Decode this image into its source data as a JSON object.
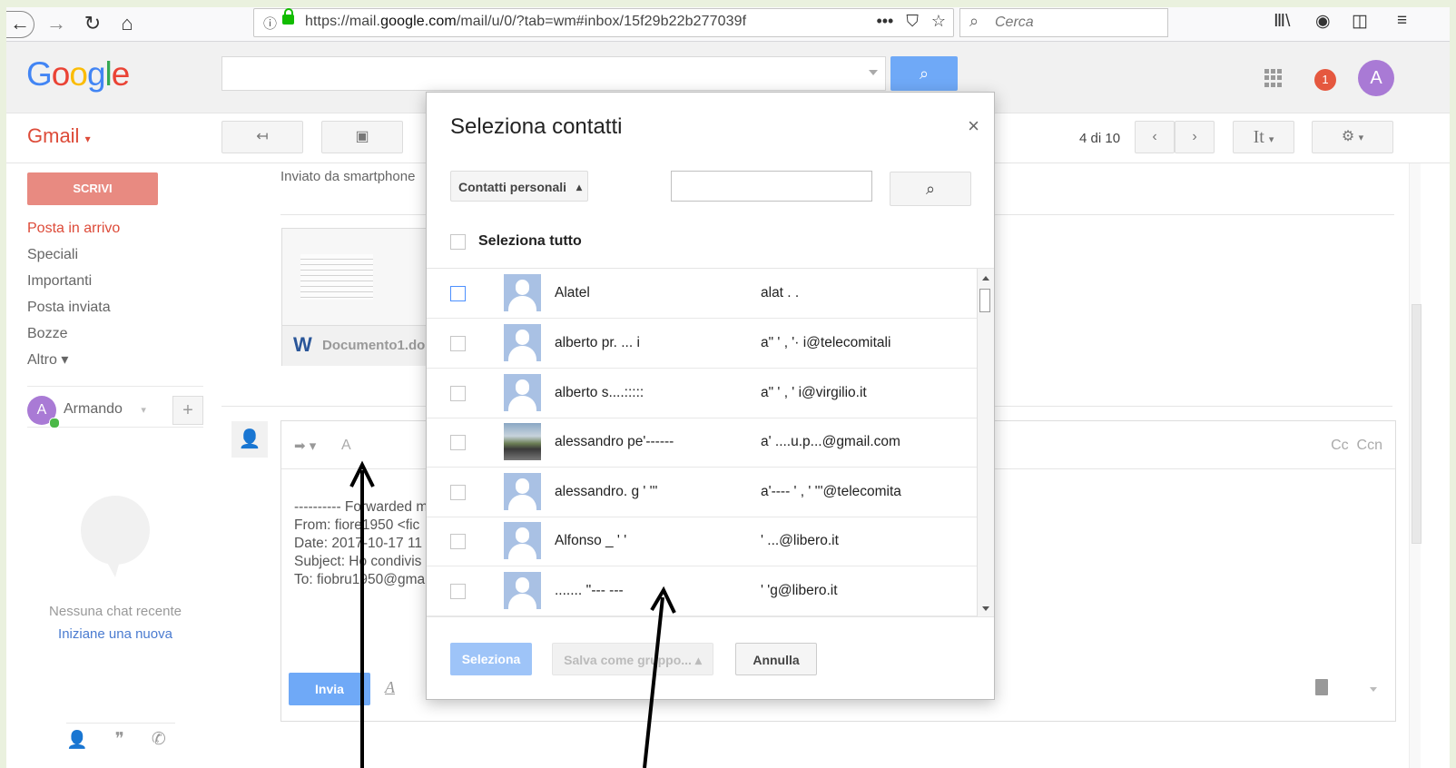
{
  "browser": {
    "url_prefix": "https://mail.",
    "url_domain": "google.com",
    "url_suffix": "/mail/u/0/?tab=wm#inbox/15f29b22b277039f",
    "search_placeholder": "Cerca",
    "icons": [
      "back-icon",
      "forward-icon",
      "reload-icon",
      "home-icon",
      "info-icon",
      "lock-icon",
      "menu-dots-icon",
      "pocket-icon",
      "star-icon",
      "search-icon",
      "library-icon",
      "extension-icon",
      "sidebar-icon",
      "hamburger-icon"
    ]
  },
  "header": {
    "logo": "Google",
    "notifications": "1",
    "avatar_letter": "A"
  },
  "toolbar": {
    "gmail_label": "Gmail",
    "pager": "4 di 10",
    "lang": "It"
  },
  "sidebar": {
    "compose_label": "SCRIVI",
    "items": [
      {
        "label": "Posta in arrivo",
        "active": true
      },
      {
        "label": "Speciali"
      },
      {
        "label": "Importanti"
      },
      {
        "label": "Posta inviata"
      },
      {
        "label": "Bozze"
      },
      {
        "label": "Altro ▾"
      }
    ],
    "hangout_user": "Armando",
    "hangout_avatar": "A",
    "no_chat": "Nessuna chat recente",
    "new_chat": "Iniziane una nuova"
  },
  "mail": {
    "sent_note": "Inviato da smartphone",
    "attachment_name": "Documento1.doc",
    "compose_to_label": "A",
    "cc": "Cc",
    "bcc": "Ccn",
    "forward_lines": [
      "---------- Forwarded m",
      "From: fiore1950 <fic",
      "Date: 2017-10-17 11",
      "Subject: Ho condivis",
      "To: fiobru1950@gma"
    ],
    "send_label": "Invia"
  },
  "dialog": {
    "title": "Seleziona contatti",
    "close": "×",
    "source": "Contatti personali",
    "select_all": "Seleziona tutto",
    "contacts": [
      {
        "name": "Alatel",
        "email": "alat  .  ."
      },
      {
        "name": "alberto pr.          ... i",
        "email": "a\"   '     ,          '·  i@telecomitali"
      },
      {
        "name": "alberto s....:::::",
        "email": "a\"   '     ,   '     i@virgilio.it"
      },
      {
        "name": "alessandro pe'------",
        "email": "a'        ....u.p...@gmail.com"
      },
      {
        "name": "alessandro. g   '       '''",
        "email": "a'----   '    ,  '  '''@telecomita"
      },
      {
        "name": "Alfonso _   ' '",
        "email": "'          ...@libero.it"
      },
      {
        "name": ".......          ''---  ---",
        "email": "  ' 'g@libero.it"
      }
    ],
    "btn_select": "Seleziona",
    "btn_group": "Salva come gruppo... ▴",
    "btn_cancel": "Annulla"
  }
}
